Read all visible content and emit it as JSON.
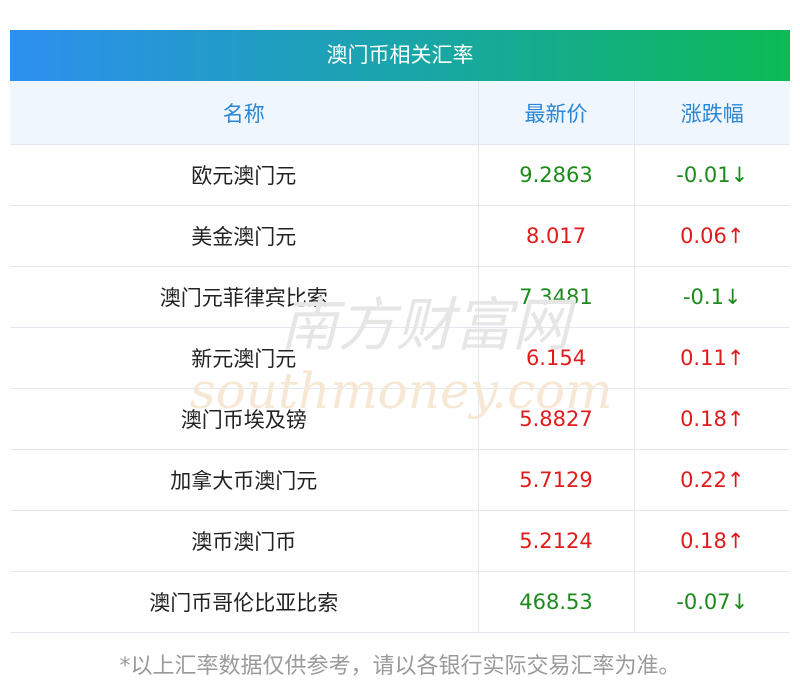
{
  "title": "澳门币相关汇率",
  "headers": {
    "name": "名称",
    "latest": "最新价",
    "change": "涨跌幅"
  },
  "rows": [
    {
      "name": "欧元澳门元",
      "price": "9.2863",
      "change": "-0.01↓",
      "direction": "down"
    },
    {
      "name": "美金澳门元",
      "price": "8.017",
      "change": "0.06↑",
      "direction": "up"
    },
    {
      "name": "澳门元菲律宾比索",
      "price": "7.3481",
      "change": "-0.1↓",
      "direction": "down"
    },
    {
      "name": "新元澳门元",
      "price": "6.154",
      "change": "0.11↑",
      "direction": "up"
    },
    {
      "name": "澳门币埃及镑",
      "price": "5.8827",
      "change": "0.18↑",
      "direction": "up"
    },
    {
      "name": "加拿大币澳门元",
      "price": "5.7129",
      "change": "0.22↑",
      "direction": "up"
    },
    {
      "name": "澳币澳门币",
      "price": "5.2124",
      "change": "0.18↑",
      "direction": "up"
    },
    {
      "name": "澳门币哥伦比亚比索",
      "price": "468.53",
      "change": "-0.07↓",
      "direction": "down"
    }
  ],
  "watermark": {
    "cn": "南方财富网",
    "en": "southmoney.com"
  },
  "footnote": "*以上汇率数据仅供参考，请以各银行实际交易汇率为准。",
  "colors": {
    "up": "#e01b1b",
    "down": "#1d8a1d",
    "header_text": "#2a86d6",
    "header_bg": "#f0f6fd"
  }
}
